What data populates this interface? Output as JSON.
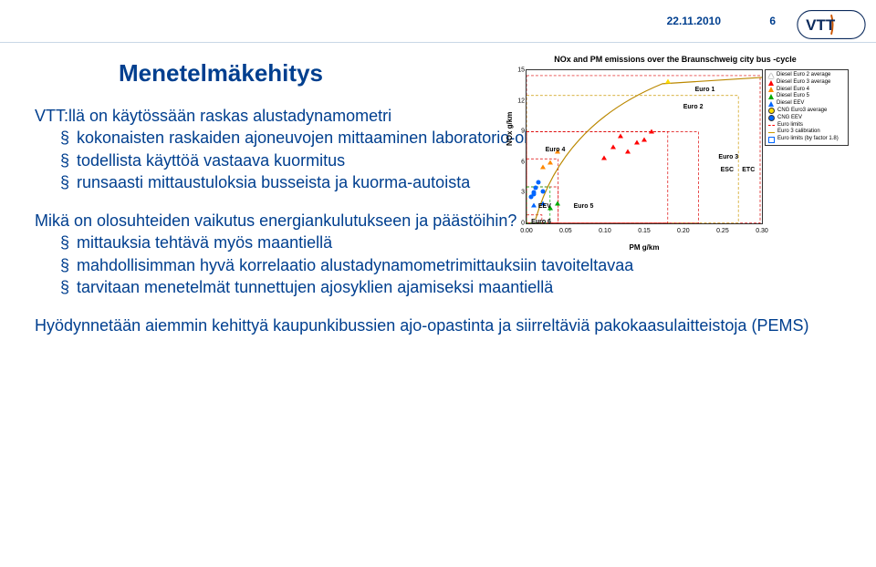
{
  "header": {
    "date": "22.11.2010",
    "page": "6",
    "logo_text": "VTT"
  },
  "title": "Menetelmäkehitys",
  "block1_intro": "VTT:llä on käytössään raskas alustadynamometri",
  "block1_items": [
    "kokonaisten raskaiden ajoneuvojen mittaaminen laboratorio-olosuhteissa",
    "todellista käyttöä vastaava kuormitus",
    "runsaasti mittaustuloksia busseista ja kuorma-autoista"
  ],
  "block2_intro": "Mikä on olosuhteiden vaikutus energiankulutukseen ja päästöihin?",
  "block2_items": [
    "mittauksia tehtävä myös maantiellä",
    "mahdollisimman hyvä korrelaatio alustadynamometrimittauksiin tavoiteltavaa",
    "tarvitaan menetelmät tunnettujen ajosyklien ajamiseksi maantiellä"
  ],
  "block3": "Hyödynnetään aiemmin kehittyä kaupunkibussien ajo-opastinta ja siirreltäviä pakokaasulaitteistoja (PEMS)",
  "chart": {
    "title": "NOx and PM emissions over the Braunschweig city bus -cycle",
    "xlabel": "PM g/km",
    "ylabel": "NOx g/km",
    "xticks": [
      "0.00",
      "0.05",
      "0.10",
      "0.15",
      "0.20",
      "0.25",
      "0.30"
    ],
    "yticks": [
      "0",
      "3",
      "6",
      "9",
      "12",
      "15"
    ],
    "legend": [
      {
        "label": "Diesel Euro 2 average",
        "color": "transparent",
        "shape": "tri",
        "border": "#000"
      },
      {
        "label": "Diesel Euro 3 average",
        "color": "#ff0000",
        "shape": "tri"
      },
      {
        "label": "Diesel Euro 4",
        "color": "#ff8800",
        "shape": "tri"
      },
      {
        "label": "Diesel Euro 5",
        "color": "#00aa00",
        "shape": "tri"
      },
      {
        "label": "Diesel EEV",
        "color": "#0066ff",
        "shape": "tri"
      },
      {
        "label": "CNG Euro3 average",
        "color": "#ffdd00",
        "shape": "circ"
      },
      {
        "label": "CNG EEV",
        "color": "#0066ff",
        "shape": "circ"
      },
      {
        "label": "Euro limits",
        "color": "#ff0000",
        "shape": "line"
      },
      {
        "label": "Euro 3 calibration",
        "color": "#cc9900",
        "shape": "line"
      },
      {
        "label": "Euro limits (by factor 1.8)",
        "color": "#0066ff",
        "shape": "sq"
      }
    ],
    "annotations": [
      "Euro 1",
      "Euro 2",
      "Euro 3",
      "Euro 4",
      "Euro 5",
      "Euro 6",
      "EEV",
      "ESC",
      "ETC"
    ]
  },
  "chart_data": {
    "type": "scatter",
    "title": "NOx and PM emissions over the Braunschweig city bus -cycle",
    "xlabel": "PM g/km",
    "ylabel": "NOx g/km",
    "xlim": [
      0.0,
      0.3
    ],
    "ylim": [
      0,
      15
    ],
    "series": [
      {
        "name": "Diesel Euro 3 average",
        "points": [
          [
            0.14,
            8
          ],
          [
            0.16,
            9
          ],
          [
            0.12,
            8.5
          ],
          [
            0.11,
            7.5
          ],
          [
            0.1,
            6.5
          ],
          [
            0.13,
            7
          ],
          [
            0.15,
            8.2
          ]
        ]
      },
      {
        "name": "Diesel Euro 4",
        "points": [
          [
            0.03,
            6
          ],
          [
            0.04,
            7
          ],
          [
            0.02,
            5.5
          ]
        ]
      },
      {
        "name": "Diesel Euro 5",
        "points": [
          [
            0.04,
            2
          ],
          [
            0.03,
            1.5
          ]
        ]
      },
      {
        "name": "Diesel EEV",
        "points": [
          [
            0.02,
            2
          ],
          [
            0.01,
            1.8
          ]
        ]
      },
      {
        "name": "CNG EEV",
        "points": [
          [
            0.01,
            3
          ],
          [
            0.015,
            4
          ],
          [
            0.005,
            2.5
          ],
          [
            0.012,
            3.5
          ],
          [
            0.008,
            2.8
          ],
          [
            0.02,
            3.2
          ]
        ]
      },
      {
        "name": "CNG Euro3 average",
        "points": [
          [
            0.18,
            14
          ]
        ]
      }
    ],
    "limit_boxes": [
      {
        "name": "Euro 1",
        "xmax": 0.3,
        "ymax": 14.5
      },
      {
        "name": "Euro 2",
        "xmax": 0.27,
        "ymax": 12.5
      },
      {
        "name": "Euro 3 ESC",
        "xmax": 0.18,
        "ymax": 9
      },
      {
        "name": "Euro 3 ETC",
        "xmax": 0.22,
        "ymax": 9
      },
      {
        "name": "Euro 4",
        "xmax": 0.04,
        "ymax": 6.3
      },
      {
        "name": "Euro 5",
        "xmax": 0.04,
        "ymax": 3.6
      },
      {
        "name": "Euro 6",
        "xmax": 0.02,
        "ymax": 0.8
      },
      {
        "name": "EEV",
        "xmax": 0.03,
        "ymax": 3.6
      }
    ]
  }
}
